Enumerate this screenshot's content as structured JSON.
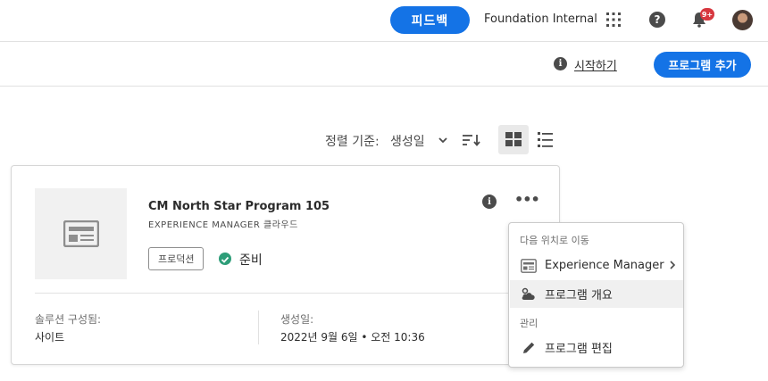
{
  "header": {
    "feedback_label": "피드백",
    "org_name": "Foundation Internal",
    "notification_badge": "9+",
    "icons": [
      "apps-grid-icon",
      "help-icon",
      "bell-icon",
      "avatar"
    ]
  },
  "actionbar": {
    "getting_started_label": "시작하기",
    "add_program_label": "프로그램 추가"
  },
  "toolbar": {
    "sort_label": "정렬 기준:",
    "sort_value": "생성일",
    "view_mode": "grid"
  },
  "card": {
    "title": "CM North Star Program 105",
    "subtitle": "EXPERIENCE MANAGER 클라우드",
    "environment_tag": "프로덕션",
    "status": "준비",
    "solutions_label": "솔루션 구성됨:",
    "solutions_value": "사이트",
    "created_label": "생성일:",
    "created_value": "2022년 9월 6일 • 오전 10:36"
  },
  "menu": {
    "nav_section": "다음 위치로 이동",
    "item_experience_manager": "Experience Manager",
    "item_program_overview": "프로그램 개요",
    "manage_section": "관리",
    "item_edit_program": "프로그램 편집"
  },
  "colors": {
    "accent": "#1473e6",
    "status_ready": "#2d9d78",
    "badge": "#d7373f"
  }
}
